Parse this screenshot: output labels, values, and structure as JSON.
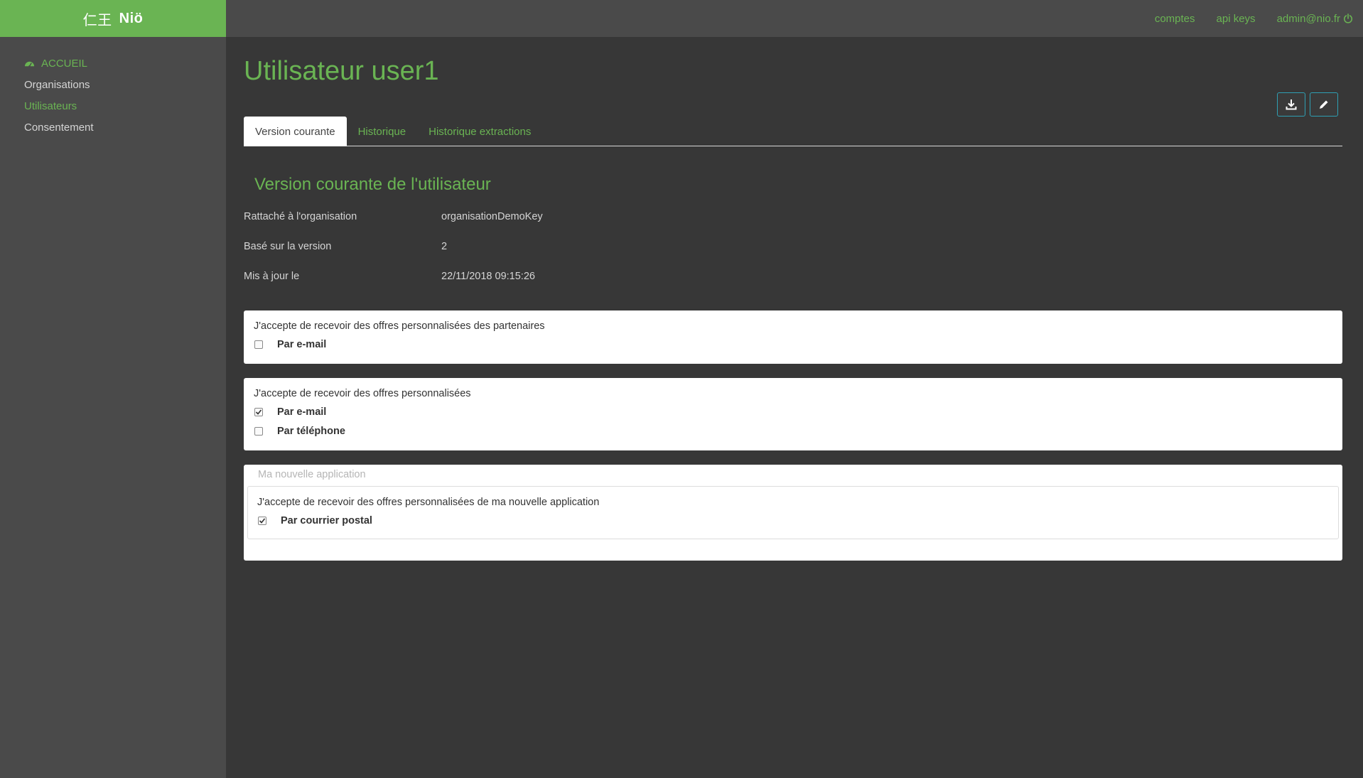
{
  "brand": {
    "kanji": "仁王",
    "name": "Niö"
  },
  "topbar": {
    "links": [
      "comptes",
      "api keys",
      "admin@nio.fr"
    ],
    "logout_icon": "power-icon",
    "accent": "#6ab453"
  },
  "sidebar": {
    "home": {
      "label": "ACCUEIL",
      "icon": "dashboard-icon"
    },
    "items": [
      {
        "label": "Organisations",
        "active": false
      },
      {
        "label": "Utilisateurs",
        "active": true
      },
      {
        "label": "Consentement",
        "active": false
      }
    ]
  },
  "main": {
    "title": "Utilisateur user1",
    "actions": {
      "download_icon": "download-icon",
      "edit_icon": "pencil-icon"
    },
    "tabs": [
      {
        "label": "Version courante",
        "active": true
      },
      {
        "label": "Historique",
        "active": false
      },
      {
        "label": "Historique extractions",
        "active": false
      }
    ],
    "section_title": "Version courante de l'utilisateur",
    "info": [
      {
        "label": "Rattaché à l'organisation",
        "value": "organisationDemoKey"
      },
      {
        "label": "Basé sur la version",
        "value": "2"
      },
      {
        "label": "Mis à jour le",
        "value": "22/11/2018 09:15:26"
      }
    ],
    "consents": [
      {
        "title": "J'accepte de recevoir des offres personnalisées des partenaires",
        "options": [
          {
            "label": "Par e-mail",
            "checked": false
          }
        ]
      },
      {
        "title": "J'accepte de recevoir des offres personnalisées",
        "options": [
          {
            "label": "Par e-mail",
            "checked": true
          },
          {
            "label": "Par téléphone",
            "checked": false
          }
        ]
      }
    ],
    "app_consent": {
      "app_name": "Ma nouvelle application",
      "title": "J'accepte de recevoir des offres personnalisées de ma nouvelle application",
      "options": [
        {
          "label": "Par courrier postal",
          "checked": true
        }
      ]
    }
  }
}
